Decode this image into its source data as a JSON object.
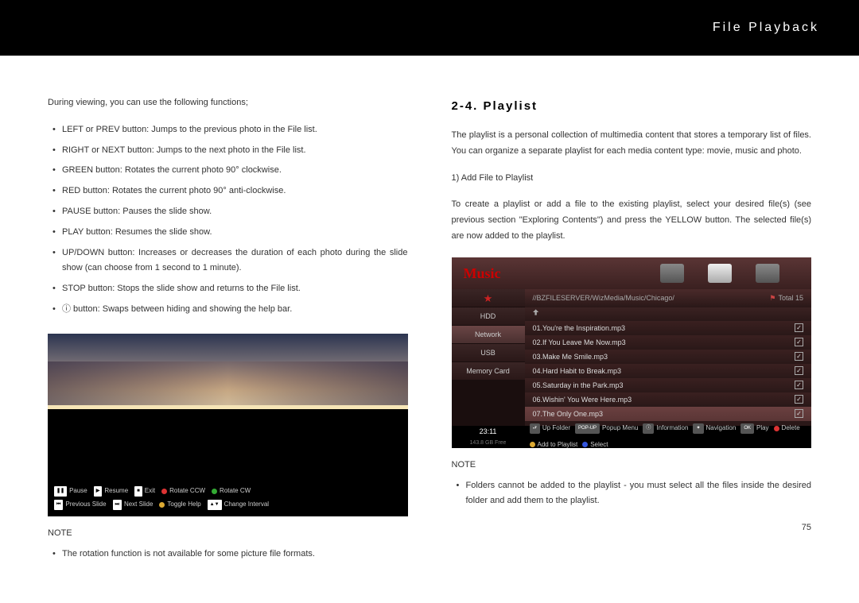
{
  "header": {
    "title": "File Playback"
  },
  "left": {
    "intro": "During viewing, you can use the following functions;",
    "bullets": [
      "LEFT or PREV button: Jumps to the previous photo in the File list.",
      "RIGHT or NEXT button: Jumps to the next photo in the File list.",
      "GREEN button: Rotates the current photo 90° clockwise.",
      "RED button: Rotates the current photo 90° anti-clockwise.",
      "PAUSE button: Pauses the slide show.",
      "PLAY button: Resumes the slide show.",
      "UP/DOWN button: Increases or decreases the duration of each photo during the slide show (can choose from 1 second to 1 minute).",
      "STOP button: Stops the slide show and returns to the File list.",
      "ⓘ button: Swaps between hiding and showing the help bar."
    ],
    "helpbar": {
      "row1": [
        {
          "icon": "❚❚",
          "label": "Pause"
        },
        {
          "icon": "▶",
          "label": "Resume"
        },
        {
          "icon": "■",
          "label": "Exit"
        },
        {
          "dot": "red",
          "label": "Rotate CCW"
        },
        {
          "dot": "green",
          "label": "Rotate CW"
        }
      ],
      "row2": [
        {
          "icon": "⏮",
          "label": "Previous Slide"
        },
        {
          "icon": "⏭",
          "label": "Next Slide"
        },
        {
          "dot": "yellow",
          "label": "Toggle Help"
        },
        {
          "icon": "▲▼",
          "label": "Change Interval"
        }
      ]
    },
    "note_label": "NOTE",
    "note_bullets": [
      "The rotation function is not available for some picture file formats."
    ]
  },
  "right": {
    "heading": "2-4. Playlist",
    "para1": "The playlist is a personal collection of multimedia content that stores a temporary list of files.  You can organize a separate playlist for each media content type: movie, music and photo.",
    "sub1": "1) Add File to Playlist",
    "para2": "To create a playlist or add a file to the existing playlist, select your desired file(s) (see previous section \"Exploring Contents\") and press the YELLOW button.   The selected file(s) are now added to the playlist.",
    "music_ui": {
      "tab_label": "Music",
      "path": "//BZFILESERVER/WizMedia/Music/Chicago/",
      "total": "Total 15",
      "sidebar": [
        "★",
        "HDD",
        "Network",
        "USB",
        "Memory Card"
      ],
      "sidebar_selected_index": 2,
      "files": [
        {
          "name": "01.You're the Inspiration.mp3",
          "checked": true
        },
        {
          "name": "02.If You Leave Me Now.mp3",
          "checked": true
        },
        {
          "name": "03.Make Me Smile.mp3",
          "checked": true
        },
        {
          "name": "04.Hard Habit to Break.mp3",
          "checked": true
        },
        {
          "name": "05.Saturday in the Park.mp3",
          "checked": true
        },
        {
          "name": "06.Wishin' You Were Here.mp3",
          "checked": true
        },
        {
          "name": "07.The Only One.mp3",
          "checked": true
        }
      ],
      "selected_index": 6,
      "time": "23:11",
      "free": "143.8 GB Free",
      "bottom": [
        {
          "icon": "⮐",
          "label": "Up Folder"
        },
        {
          "icon": "POP-UP",
          "label": "Popup Menu"
        },
        {
          "icon": "ⓘ",
          "label": "Information"
        },
        {
          "icon": "✦",
          "label": "Navigation"
        },
        {
          "icon": "OK",
          "label": "Play"
        },
        {
          "dot": "red",
          "label": "Delete"
        },
        {
          "dot": "yellow",
          "label": "Add to Playlist"
        },
        {
          "dot": "blue",
          "label": "Select"
        }
      ]
    },
    "note_label": "NOTE",
    "note_bullets": [
      "Folders cannot be added to the playlist - you must select all the files inside the desired folder and add them to the playlist."
    ]
  },
  "page_number": "75"
}
